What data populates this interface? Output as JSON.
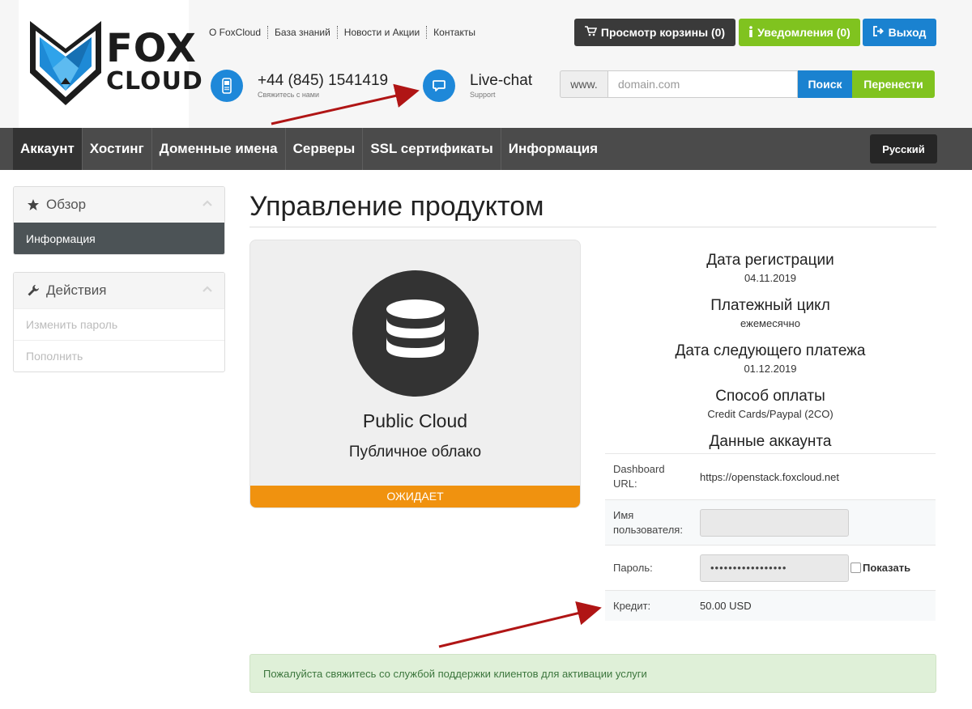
{
  "brand": {
    "line1": "FOX",
    "line2": "CLOUD"
  },
  "top_links": [
    "О FoxCloud",
    "База знаний",
    "Новости и Акции",
    "Контакты"
  ],
  "contacts": {
    "phone": {
      "number": "+44 (845) 1541419",
      "sub": "Свяжитесь с нами",
      "icon": "phone-icon"
    },
    "chat": {
      "label": "Live-chat",
      "sub": "Support",
      "icon": "chat-icon"
    }
  },
  "top_buttons": {
    "cart": "Просмотр корзины (0)",
    "notifications": "Уведомления (0)",
    "logout": "Выход"
  },
  "domain_search": {
    "prefix": "www.",
    "placeholder": "domain.com",
    "search_label": "Поиск",
    "transfer_label": "Перенести"
  },
  "nav": {
    "items": [
      "Аккаунт",
      "Хостинг",
      "Доменные имена",
      "Серверы",
      "SSL сертификаты",
      "Информация"
    ],
    "language": "Русский"
  },
  "sidebar": {
    "overview": {
      "title": "Обзор",
      "items": [
        "Информация"
      ]
    },
    "actions": {
      "title": "Действия",
      "items": [
        "Изменить пароль",
        "Пополнить"
      ]
    }
  },
  "page_title": "Управление продуктом",
  "product": {
    "name": "Public Cloud",
    "subtitle": "Публичное облако",
    "status": "ОЖИДАЕТ"
  },
  "details": [
    {
      "label": "Дата регистрации",
      "value": "04.11.2019"
    },
    {
      "label": "Платежный цикл",
      "value": "ежемесячно"
    },
    {
      "label": "Дата следующего платежа",
      "value": "01.12.2019"
    },
    {
      "label": "Способ оплаты",
      "value": "Credit Cards/Paypal (2CO)"
    }
  ],
  "account": {
    "heading": "Данные аккаунта",
    "dashboard_label": "Dashboard URL:",
    "dashboard_url": "https://openstack.foxcloud.net",
    "username_label": "Имя пользователя:",
    "username_value": "",
    "password_label": "Пароль:",
    "password_value": "•••••••••••••••••",
    "show_label": "Показать",
    "credit_label": "Кредит:",
    "credit_value": "50.00 USD"
  },
  "alert": "Пожалуйста свяжитесь со службой поддержки клиентов для активации услуги",
  "colors": {
    "nav_bg": "#4b4b4b",
    "cart_btn": "#3a3a3a",
    "notify_btn": "#80c31f",
    "logout_btn": "#1a82d0",
    "search_btn": "#1a82d0",
    "transfer_btn": "#80c31f",
    "status_orange": "#f0920f",
    "arrow_red": "#b01515"
  }
}
